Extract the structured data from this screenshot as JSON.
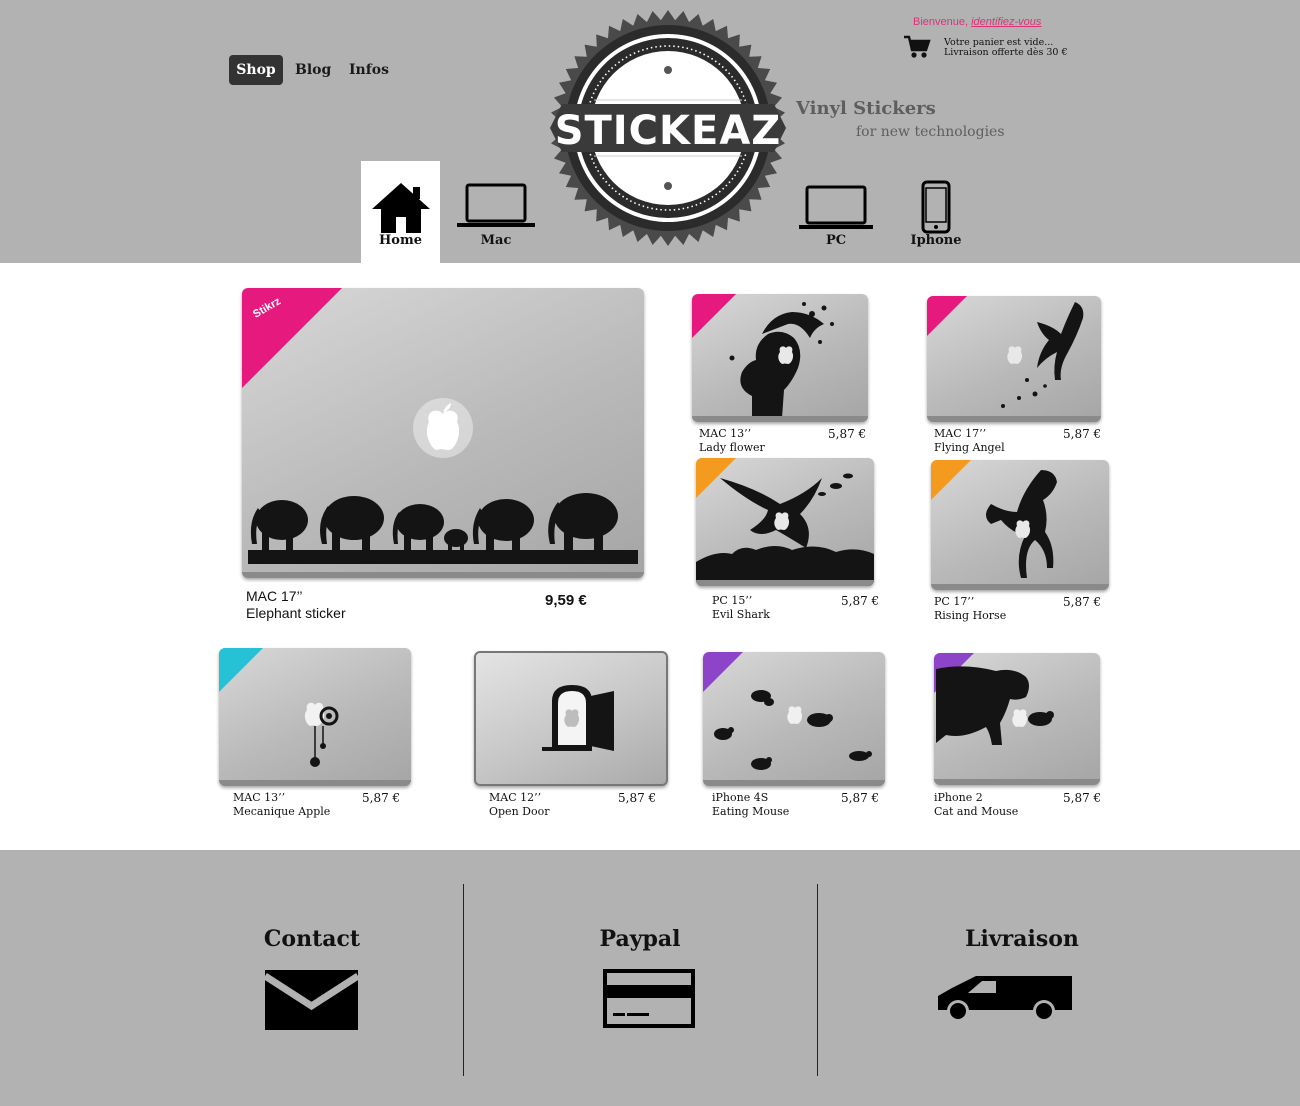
{
  "header": {
    "nav": [
      "Shop",
      "Blog",
      "Infos"
    ],
    "welcome": "Bienvenue,",
    "login_link": "identifiez-vous",
    "cart_line1": "Votre panier est vide...",
    "cart_line2": "Livraison offerte dès 30 €",
    "logo_text": "STICKEAZ",
    "tagline_main": "Vinyl Stickers",
    "tagline_sub": "for new technologies",
    "categories": [
      "Home",
      "Mac",
      "PC",
      "Iphone"
    ],
    "active_category": "Home"
  },
  "products": [
    {
      "model": "MAC 17’’",
      "name": "Elephant sticker",
      "price": "9,59 €",
      "ribbon_color": "#e5197e",
      "ribbon_label": "Stikrz"
    },
    {
      "model": "MAC  13’’",
      "name": "Lady flower",
      "price": "5,87 €",
      "ribbon_color": "#e5197e"
    },
    {
      "model": "MAC 17’’",
      "name": "Flying Angel",
      "price": "5,87 €",
      "ribbon_color": "#e5197e"
    },
    {
      "model": "PC 15’’",
      "name": "Evil Shark",
      "price": "5,87 €",
      "ribbon_color": "#f39a1f"
    },
    {
      "model": "PC 17’’",
      "name": "Rising Horse",
      "price": "5,87 €",
      "ribbon_color": "#f39a1f"
    },
    {
      "model": "MAC 13’’",
      "name": "Mecanique Apple",
      "price": "5,87 €",
      "ribbon_color": "#27c1d6"
    },
    {
      "model": "MAC 12’’",
      "name": "Open Door",
      "price": "5,87 €",
      "ribbon_color": ""
    },
    {
      "model": "iPhone 4S",
      "name": "Eating Mouse",
      "price": "5,87 €",
      "ribbon_color": "#8e44c9"
    },
    {
      "model": "iPhone 2",
      "name": "Cat and Mouse",
      "price": "5,87 €",
      "ribbon_color": "#8e44c9"
    }
  ],
  "footer": {
    "contact": "Contact",
    "paypal": "Paypal",
    "livraison": "Livraison"
  },
  "colors": {
    "header_bg": "#b2b2b2",
    "shop_button_bg": "#333333",
    "accent_pink": "#e0307a",
    "tagline": "#5e5e5e"
  },
  "icons": [
    "cart-icon",
    "home-icon",
    "laptop-icon",
    "phone-icon",
    "envelope-icon",
    "credit-card-icon",
    "truck-icon",
    "apple-logo-icon"
  ]
}
